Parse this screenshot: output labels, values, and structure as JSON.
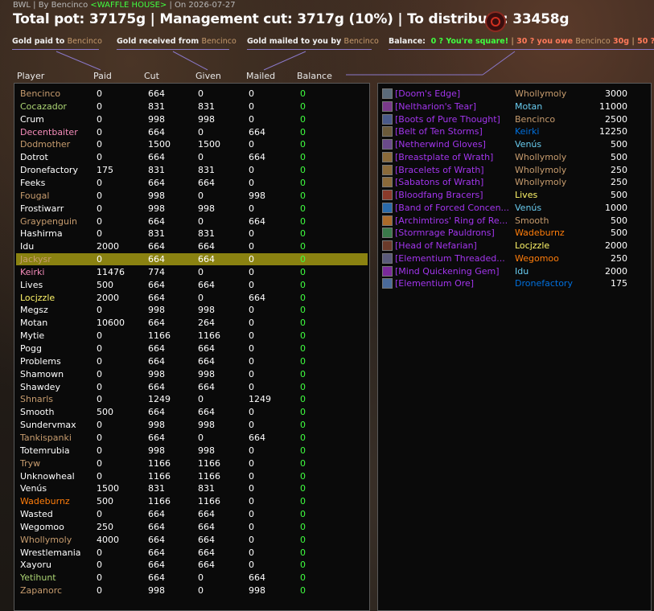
{
  "header": {
    "subtitle_prefix": "BWL | By Bencinco",
    "guild": "<WAFFLE HOUSE>",
    "subtitle_suffix": "| On 2026-07-27",
    "title": "Total pot: 37175g | Management cut: 3717g (10%) | To distribute: 33458g"
  },
  "legend": {
    "paid_text": "Gold paid to",
    "received_text": "Gold received from",
    "mailed_text": "Gold mailed to you by",
    "name": "Bencinco",
    "balance_text": "Balance:",
    "balance_square": "0 ? You're square!",
    "balance_owe_prefix": "30 ? you owe",
    "balance_owe_amount": "30g",
    "balance_third": "50 ?"
  },
  "columns": [
    "Player",
    "Paid",
    "Cut",
    "Given",
    "Mailed",
    "Balance"
  ],
  "colors": {
    "warrior": "#c79c6e",
    "paladin": "#f58cba",
    "hunter": "#abd473",
    "rogue": "#fff569",
    "priest": "#ffffff",
    "shaman": "#0070de",
    "mage": "#69ccf0",
    "warlock": "#9482c9",
    "druid": "#ff7d0a",
    "epic": "#a335ee",
    "balance": "#40ff40",
    "selected_row": "#8a8211"
  },
  "players": [
    {
      "name": "Bencinco",
      "paid": "0",
      "cut": "664",
      "given": "0",
      "mailed": "0",
      "balance": "0",
      "color": "#c79c6e"
    },
    {
      "name": "Cocazador",
      "paid": "0",
      "cut": "831",
      "given": "831",
      "mailed": "0",
      "balance": "0",
      "color": "#abd473"
    },
    {
      "name": "Crum",
      "paid": "0",
      "cut": "998",
      "given": "998",
      "mailed": "0",
      "balance": "0",
      "color": "#ffffff"
    },
    {
      "name": "Decentbaiter",
      "paid": "0",
      "cut": "664",
      "given": "0",
      "mailed": "664",
      "balance": "0",
      "color": "#f58cba"
    },
    {
      "name": "Dodmother",
      "paid": "0",
      "cut": "1500",
      "given": "1500",
      "mailed": "0",
      "balance": "0",
      "color": "#c79c6e"
    },
    {
      "name": "Dotrot",
      "paid": "0",
      "cut": "664",
      "given": "0",
      "mailed": "664",
      "balance": "0",
      "color": "#ffffff"
    },
    {
      "name": "Dronefactory",
      "paid": "175",
      "cut": "831",
      "given": "831",
      "mailed": "0",
      "balance": "0",
      "color": "#ffffff"
    },
    {
      "name": "Feeks",
      "paid": "0",
      "cut": "664",
      "given": "664",
      "mailed": "0",
      "balance": "0",
      "color": "#ffffff"
    },
    {
      "name": "Fougal",
      "paid": "0",
      "cut": "998",
      "given": "0",
      "mailed": "998",
      "balance": "0",
      "color": "#c79c6e"
    },
    {
      "name": "Frostiwarr",
      "paid": "0",
      "cut": "998",
      "given": "998",
      "mailed": "0",
      "balance": "0",
      "color": "#ffffff"
    },
    {
      "name": "Graypenguin",
      "paid": "0",
      "cut": "664",
      "given": "0",
      "mailed": "664",
      "balance": "0",
      "color": "#c79c6e"
    },
    {
      "name": "Hashirma",
      "paid": "0",
      "cut": "831",
      "given": "831",
      "mailed": "0",
      "balance": "0",
      "color": "#ffffff"
    },
    {
      "name": "Idu",
      "paid": "2000",
      "cut": "664",
      "given": "664",
      "mailed": "0",
      "balance": "0",
      "color": "#ffffff"
    },
    {
      "name": "Jackysr",
      "paid": "0",
      "cut": "664",
      "given": "664",
      "mailed": "0",
      "balance": "0",
      "color": "#c79c6e",
      "selected": true
    },
    {
      "name": "Keirki",
      "paid": "11476",
      "cut": "774",
      "given": "0",
      "mailed": "0",
      "balance": "0",
      "color": "#f58cba"
    },
    {
      "name": "Lives",
      "paid": "500",
      "cut": "664",
      "given": "664",
      "mailed": "0",
      "balance": "0",
      "color": "#ffffff"
    },
    {
      "name": "Locjzzle",
      "paid": "2000",
      "cut": "664",
      "given": "0",
      "mailed": "664",
      "balance": "0",
      "color": "#fff569"
    },
    {
      "name": "Megsz",
      "paid": "0",
      "cut": "998",
      "given": "998",
      "mailed": "0",
      "balance": "0",
      "color": "#ffffff"
    },
    {
      "name": "Motan",
      "paid": "10600",
      "cut": "664",
      "given": "264",
      "mailed": "0",
      "balance": "0",
      "color": "#ffffff"
    },
    {
      "name": "Mytie",
      "paid": "0",
      "cut": "1166",
      "given": "1166",
      "mailed": "0",
      "balance": "0",
      "color": "#ffffff"
    },
    {
      "name": "Pogg",
      "paid": "0",
      "cut": "664",
      "given": "664",
      "mailed": "0",
      "balance": "0",
      "color": "#ffffff"
    },
    {
      "name": "Problems",
      "paid": "0",
      "cut": "664",
      "given": "664",
      "mailed": "0",
      "balance": "0",
      "color": "#ffffff"
    },
    {
      "name": "Shamown",
      "paid": "0",
      "cut": "998",
      "given": "998",
      "mailed": "0",
      "balance": "0",
      "color": "#ffffff"
    },
    {
      "name": "Shawdey",
      "paid": "0",
      "cut": "664",
      "given": "664",
      "mailed": "0",
      "balance": "0",
      "color": "#ffffff"
    },
    {
      "name": "Shnarls",
      "paid": "0",
      "cut": "1249",
      "given": "0",
      "mailed": "1249",
      "balance": "0",
      "color": "#c79c6e"
    },
    {
      "name": "Smooth",
      "paid": "500",
      "cut": "664",
      "given": "664",
      "mailed": "0",
      "balance": "0",
      "color": "#ffffff"
    },
    {
      "name": "Sundervmax",
      "paid": "0",
      "cut": "998",
      "given": "998",
      "mailed": "0",
      "balance": "0",
      "color": "#ffffff"
    },
    {
      "name": "Tankispanki",
      "paid": "0",
      "cut": "664",
      "given": "0",
      "mailed": "664",
      "balance": "0",
      "color": "#c79c6e"
    },
    {
      "name": "Totemrubia",
      "paid": "0",
      "cut": "998",
      "given": "998",
      "mailed": "0",
      "balance": "0",
      "color": "#ffffff"
    },
    {
      "name": "Tryw",
      "paid": "0",
      "cut": "1166",
      "given": "1166",
      "mailed": "0",
      "balance": "0",
      "color": "#c79c6e"
    },
    {
      "name": "Unknowheal",
      "paid": "0",
      "cut": "1166",
      "given": "1166",
      "mailed": "0",
      "balance": "0",
      "color": "#ffffff"
    },
    {
      "name": "Venús",
      "paid": "1500",
      "cut": "831",
      "given": "831",
      "mailed": "0",
      "balance": "0",
      "color": "#ffffff"
    },
    {
      "name": "Wadeburnz",
      "paid": "500",
      "cut": "1166",
      "given": "1166",
      "mailed": "0",
      "balance": "0",
      "color": "#ff7d0a"
    },
    {
      "name": "Wasted",
      "paid": "0",
      "cut": "664",
      "given": "664",
      "mailed": "0",
      "balance": "0",
      "color": "#ffffff"
    },
    {
      "name": "Wegomoo",
      "paid": "250",
      "cut": "664",
      "given": "664",
      "mailed": "0",
      "balance": "0",
      "color": "#ffffff"
    },
    {
      "name": "Whollymoly",
      "paid": "4000",
      "cut": "664",
      "given": "664",
      "mailed": "0",
      "balance": "0",
      "color": "#c79c6e"
    },
    {
      "name": "Wrestlemania",
      "paid": "0",
      "cut": "664",
      "given": "664",
      "mailed": "0",
      "balance": "0",
      "color": "#ffffff"
    },
    {
      "name": "Xayoru",
      "paid": "0",
      "cut": "664",
      "given": "664",
      "mailed": "0",
      "balance": "0",
      "color": "#ffffff"
    },
    {
      "name": "Yetihunt",
      "paid": "0",
      "cut": "664",
      "given": "0",
      "mailed": "664",
      "balance": "0",
      "color": "#abd473"
    },
    {
      "name": "Zapanorc",
      "paid": "0",
      "cut": "998",
      "given": "0",
      "mailed": "998",
      "balance": "0",
      "color": "#c79c6e"
    }
  ],
  "items": [
    {
      "item": "[Doom's Edge]",
      "winner": "Whollymoly",
      "amount": "3000",
      "winner_color": "#c79c6e",
      "icon": "sword-icon",
      "icon_color": "#5a6a7a"
    },
    {
      "item": "[Neltharion's Tear]",
      "winner": "Motan",
      "amount": "11000",
      "winner_color": "#69ccf0",
      "icon": "trinket-icon",
      "icon_color": "#7a3a8a"
    },
    {
      "item": "[Boots of Pure Thought]",
      "winner": "Bencinco",
      "amount": "2500",
      "winner_color": "#c79c6e",
      "icon": "boots-icon",
      "icon_color": "#4a5a8a"
    },
    {
      "item": "[Belt of Ten Storms]",
      "winner": "Keirki",
      "amount": "12250",
      "winner_color": "#0070de",
      "icon": "belt-icon",
      "icon_color": "#6a5a3a"
    },
    {
      "item": "[Netherwind Gloves]",
      "winner": "Venús",
      "amount": "500",
      "winner_color": "#69ccf0",
      "icon": "gloves-icon",
      "icon_color": "#6a4a8a"
    },
    {
      "item": "[Breastplate of Wrath]",
      "winner": "Whollymoly",
      "amount": "500",
      "winner_color": "#c79c6e",
      "icon": "chest-icon",
      "icon_color": "#8a6a3a"
    },
    {
      "item": "[Bracelets of Wrath]",
      "winner": "Whollymoly",
      "amount": "250",
      "winner_color": "#c79c6e",
      "icon": "bracer-icon",
      "icon_color": "#8a6a3a"
    },
    {
      "item": "[Sabatons of Wrath]",
      "winner": "Whollymoly",
      "amount": "250",
      "winner_color": "#c79c6e",
      "icon": "boots-icon",
      "icon_color": "#8a6a3a"
    },
    {
      "item": "[Bloodfang Bracers]",
      "winner": "Lives",
      "amount": "500",
      "winner_color": "#fff569",
      "icon": "bracer-icon",
      "icon_color": "#8a3a2a"
    },
    {
      "item": "[Band of Forced Concen...",
      "winner": "Venús",
      "amount": "1000",
      "winner_color": "#69ccf0",
      "icon": "ring-icon",
      "icon_color": "#2a6aaa"
    },
    {
      "item": "[Archimtiros' Ring of Re...",
      "winner": "Smooth",
      "amount": "500",
      "winner_color": "#c79c6e",
      "icon": "ring-icon",
      "icon_color": "#aa6a2a"
    },
    {
      "item": "[Stormrage Pauldrons]",
      "winner": "Wadeburnz",
      "amount": "500",
      "winner_color": "#ff7d0a",
      "icon": "shoulder-icon",
      "icon_color": "#3a7a4a"
    },
    {
      "item": "[Head of Nefarian]",
      "winner": "Locjzzle",
      "amount": "2000",
      "winner_color": "#fff569",
      "icon": "head-icon",
      "icon_color": "#6a3a2a"
    },
    {
      "item": "[Elementium Threaded...",
      "winner": "Wegomoo",
      "amount": "250",
      "winner_color": "#ff7d0a",
      "icon": "cloak-icon",
      "icon_color": "#5a5a7a"
    },
    {
      "item": "[Mind Quickening Gem]",
      "winner": "Idu",
      "amount": "2000",
      "winner_color": "#69ccf0",
      "icon": "gem-icon",
      "icon_color": "#7a2a9a"
    },
    {
      "item": "[Elementium Ore]",
      "winner": "Dronefactory",
      "amount": "175",
      "winner_color": "#0070de",
      "icon": "ore-icon",
      "icon_color": "#4a6a9a"
    }
  ]
}
